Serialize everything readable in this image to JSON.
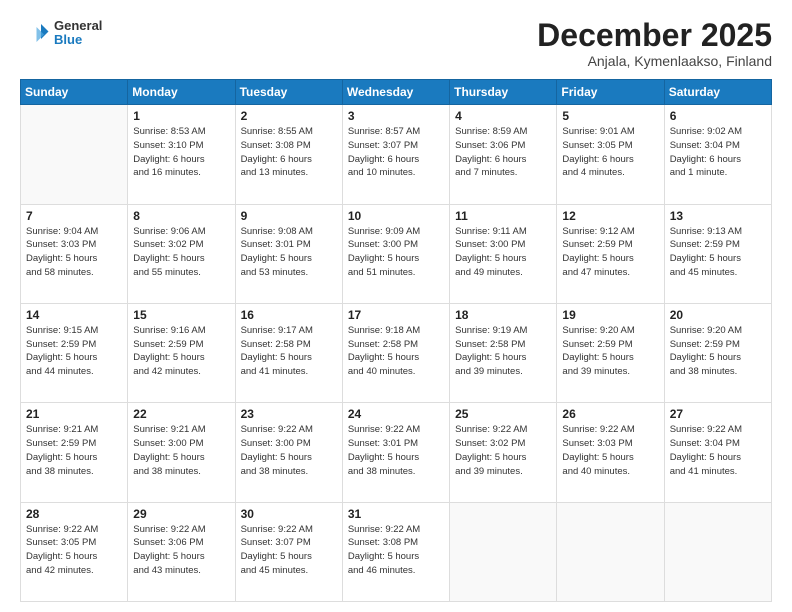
{
  "header": {
    "logo_general": "General",
    "logo_blue": "Blue",
    "month_title": "December 2025",
    "location": "Anjala, Kymenlaakso, Finland"
  },
  "days_of_week": [
    "Sunday",
    "Monday",
    "Tuesday",
    "Wednesday",
    "Thursday",
    "Friday",
    "Saturday"
  ],
  "weeks": [
    [
      {
        "day": "",
        "info": ""
      },
      {
        "day": "1",
        "info": "Sunrise: 8:53 AM\nSunset: 3:10 PM\nDaylight: 6 hours\nand 16 minutes."
      },
      {
        "day": "2",
        "info": "Sunrise: 8:55 AM\nSunset: 3:08 PM\nDaylight: 6 hours\nand 13 minutes."
      },
      {
        "day": "3",
        "info": "Sunrise: 8:57 AM\nSunset: 3:07 PM\nDaylight: 6 hours\nand 10 minutes."
      },
      {
        "day": "4",
        "info": "Sunrise: 8:59 AM\nSunset: 3:06 PM\nDaylight: 6 hours\nand 7 minutes."
      },
      {
        "day": "5",
        "info": "Sunrise: 9:01 AM\nSunset: 3:05 PM\nDaylight: 6 hours\nand 4 minutes."
      },
      {
        "day": "6",
        "info": "Sunrise: 9:02 AM\nSunset: 3:04 PM\nDaylight: 6 hours\nand 1 minute."
      }
    ],
    [
      {
        "day": "7",
        "info": "Sunrise: 9:04 AM\nSunset: 3:03 PM\nDaylight: 5 hours\nand 58 minutes."
      },
      {
        "day": "8",
        "info": "Sunrise: 9:06 AM\nSunset: 3:02 PM\nDaylight: 5 hours\nand 55 minutes."
      },
      {
        "day": "9",
        "info": "Sunrise: 9:08 AM\nSunset: 3:01 PM\nDaylight: 5 hours\nand 53 minutes."
      },
      {
        "day": "10",
        "info": "Sunrise: 9:09 AM\nSunset: 3:00 PM\nDaylight: 5 hours\nand 51 minutes."
      },
      {
        "day": "11",
        "info": "Sunrise: 9:11 AM\nSunset: 3:00 PM\nDaylight: 5 hours\nand 49 minutes."
      },
      {
        "day": "12",
        "info": "Sunrise: 9:12 AM\nSunset: 2:59 PM\nDaylight: 5 hours\nand 47 minutes."
      },
      {
        "day": "13",
        "info": "Sunrise: 9:13 AM\nSunset: 2:59 PM\nDaylight: 5 hours\nand 45 minutes."
      }
    ],
    [
      {
        "day": "14",
        "info": "Sunrise: 9:15 AM\nSunset: 2:59 PM\nDaylight: 5 hours\nand 44 minutes."
      },
      {
        "day": "15",
        "info": "Sunrise: 9:16 AM\nSunset: 2:59 PM\nDaylight: 5 hours\nand 42 minutes."
      },
      {
        "day": "16",
        "info": "Sunrise: 9:17 AM\nSunset: 2:58 PM\nDaylight: 5 hours\nand 41 minutes."
      },
      {
        "day": "17",
        "info": "Sunrise: 9:18 AM\nSunset: 2:58 PM\nDaylight: 5 hours\nand 40 minutes."
      },
      {
        "day": "18",
        "info": "Sunrise: 9:19 AM\nSunset: 2:58 PM\nDaylight: 5 hours\nand 39 minutes."
      },
      {
        "day": "19",
        "info": "Sunrise: 9:20 AM\nSunset: 2:59 PM\nDaylight: 5 hours\nand 39 minutes."
      },
      {
        "day": "20",
        "info": "Sunrise: 9:20 AM\nSunset: 2:59 PM\nDaylight: 5 hours\nand 38 minutes."
      }
    ],
    [
      {
        "day": "21",
        "info": "Sunrise: 9:21 AM\nSunset: 2:59 PM\nDaylight: 5 hours\nand 38 minutes."
      },
      {
        "day": "22",
        "info": "Sunrise: 9:21 AM\nSunset: 3:00 PM\nDaylight: 5 hours\nand 38 minutes."
      },
      {
        "day": "23",
        "info": "Sunrise: 9:22 AM\nSunset: 3:00 PM\nDaylight: 5 hours\nand 38 minutes."
      },
      {
        "day": "24",
        "info": "Sunrise: 9:22 AM\nSunset: 3:01 PM\nDaylight: 5 hours\nand 38 minutes."
      },
      {
        "day": "25",
        "info": "Sunrise: 9:22 AM\nSunset: 3:02 PM\nDaylight: 5 hours\nand 39 minutes."
      },
      {
        "day": "26",
        "info": "Sunrise: 9:22 AM\nSunset: 3:03 PM\nDaylight: 5 hours\nand 40 minutes."
      },
      {
        "day": "27",
        "info": "Sunrise: 9:22 AM\nSunset: 3:04 PM\nDaylight: 5 hours\nand 41 minutes."
      }
    ],
    [
      {
        "day": "28",
        "info": "Sunrise: 9:22 AM\nSunset: 3:05 PM\nDaylight: 5 hours\nand 42 minutes."
      },
      {
        "day": "29",
        "info": "Sunrise: 9:22 AM\nSunset: 3:06 PM\nDaylight: 5 hours\nand 43 minutes."
      },
      {
        "day": "30",
        "info": "Sunrise: 9:22 AM\nSunset: 3:07 PM\nDaylight: 5 hours\nand 45 minutes."
      },
      {
        "day": "31",
        "info": "Sunrise: 9:22 AM\nSunset: 3:08 PM\nDaylight: 5 hours\nand 46 minutes."
      },
      {
        "day": "",
        "info": ""
      },
      {
        "day": "",
        "info": ""
      },
      {
        "day": "",
        "info": ""
      }
    ]
  ]
}
